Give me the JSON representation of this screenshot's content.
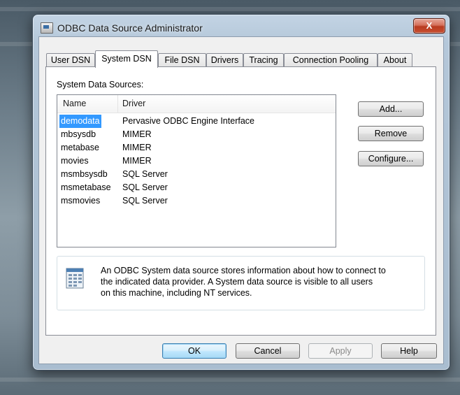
{
  "window": {
    "title": "ODBC Data Source Administrator",
    "close_label": "X"
  },
  "tabs": [
    {
      "label": "User DSN"
    },
    {
      "label": "System DSN",
      "selected": true
    },
    {
      "label": "File DSN"
    },
    {
      "label": "Drivers"
    },
    {
      "label": "Tracing"
    },
    {
      "label": "Connection Pooling"
    },
    {
      "label": "About"
    }
  ],
  "panel": {
    "section_label": "System Data Sources:",
    "columns": {
      "name": "Name",
      "driver": "Driver"
    },
    "rows": [
      {
        "name": "demodata",
        "driver": "Pervasive ODBC Engine Interface",
        "selected": true
      },
      {
        "name": "mbsysdb",
        "driver": "MIMER"
      },
      {
        "name": "metabase",
        "driver": "MIMER"
      },
      {
        "name": "movies",
        "driver": "MIMER"
      },
      {
        "name": "msmbsysdb",
        "driver": "SQL Server"
      },
      {
        "name": "msmetabase",
        "driver": "SQL Server"
      },
      {
        "name": "msmovies",
        "driver": "SQL Server"
      }
    ],
    "side_buttons": {
      "add": "Add...",
      "remove": "Remove",
      "configure": "Configure..."
    },
    "info_text": "An ODBC System data source stores information about how to connect to\nthe indicated data provider.   A System data source is visible to all users\non this machine, including NT services.",
    "info_icon": "database-document-icon"
  },
  "footer": {
    "ok": "OK",
    "cancel": "Cancel",
    "apply": "Apply",
    "help": "Help"
  },
  "colors": {
    "selection": "#3399ff",
    "default_button_border": "#3c7fb1",
    "close_button": "#c94f30"
  }
}
